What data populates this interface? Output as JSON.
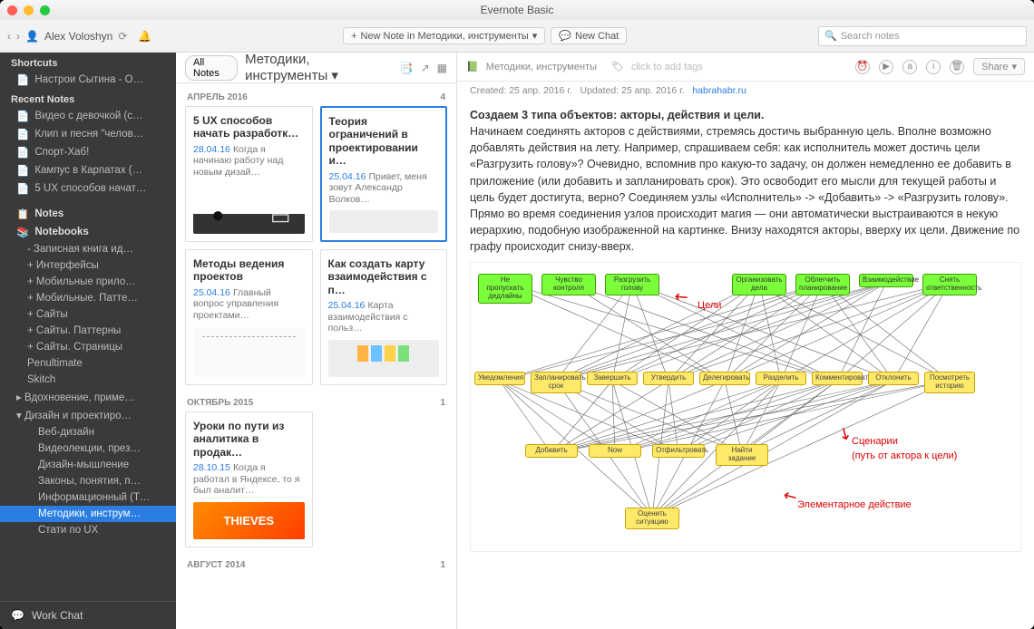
{
  "window_title": "Evernote Basic",
  "toolbar": {
    "user": "Alex Voloshyn",
    "new_note_btn": "New Note in Методики, инструменты",
    "new_chat_btn": "New Chat",
    "search_placeholder": "Search notes"
  },
  "sidebar": {
    "shortcuts_label": "Shortcuts",
    "shortcuts": [
      "Настрои Сытина - О…"
    ],
    "recent_label": "Recent Notes",
    "recent": [
      "Видео с девочкой (с…",
      "Клип и песня \"челов…",
      "Спорт-Хаб!",
      "Кампус в Карпатах (…",
      "5 UX способов начат…"
    ],
    "notes_label": "Notes",
    "notebooks_label": "Notebooks",
    "notebooks": [
      {
        "label": "- Записная книга ид…",
        "lv": 2
      },
      {
        "label": "+ Интерфейсы",
        "lv": 2
      },
      {
        "label": "+ Мобильные прило…",
        "lv": 2
      },
      {
        "label": "+ Мобильные. Патте…",
        "lv": 2
      },
      {
        "label": "+ Сайты",
        "lv": 2
      },
      {
        "label": "+ Сайты. Паттерны",
        "lv": 2
      },
      {
        "label": "+ Сайты. Страницы",
        "lv": 2
      },
      {
        "label": "Penultimate",
        "lv": 2
      },
      {
        "label": "Skitch",
        "lv": 2
      },
      {
        "label": "Вдохновение, приме…",
        "lv": 1,
        "expand": ">"
      },
      {
        "label": "Дизайн и проектиро…",
        "lv": 1,
        "expand": "v"
      },
      {
        "label": "Веб-дизайн",
        "lv": 3
      },
      {
        "label": "Видеолекции, през…",
        "lv": 3
      },
      {
        "label": "Дизайн-мышление",
        "lv": 3
      },
      {
        "label": "Законы, понятия, п…",
        "lv": 3
      },
      {
        "label": "Информационный (Т…",
        "lv": 3
      },
      {
        "label": "Методики, инструм…",
        "lv": 3,
        "selected": true
      },
      {
        "label": "Стати по UX",
        "lv": 3
      }
    ],
    "workchat": "Work Chat"
  },
  "notelist": {
    "all_notes": "All Notes",
    "title": "Методики, инструменты",
    "groups": [
      {
        "label": "АПРЕЛЬ 2016",
        "count": "4"
      },
      {
        "label": "ОКТЯБРЬ 2015",
        "count": "1"
      },
      {
        "label": "АВГУСТ 2014",
        "count": "1"
      }
    ],
    "cards": [
      {
        "title": "5 UX способов начать разработк…",
        "date": "28.04.16",
        "snippet": "Когда я начинаю работу над новым дизай…",
        "thumb": "th1"
      },
      {
        "title": "Теория ограничений в проектировании и…",
        "date": "25.04.16",
        "snippet": "Привет, меня зовут Александр Волков…",
        "thumb": "th2",
        "selected": true
      },
      {
        "title": "Методы ведения проектов",
        "date": "25.04.16",
        "snippet": "Главный вопрос управления проектами…",
        "thumb": "th3"
      },
      {
        "title": "Как создать карту взаимодействия с п…",
        "date": "25.04.16",
        "snippet": "Карта взаимодействия с польз…",
        "thumb": "th4"
      },
      {
        "title": "Уроки по пути из аналитика в продак…",
        "date": "28.10.15",
        "snippet": "Когда я работал в Яндексе, то я был аналит…",
        "thumb": "th5"
      }
    ]
  },
  "note": {
    "notebook": "Методики, инструменты",
    "tags_placeholder": "click to add tags",
    "share": "Share",
    "created": "Created: 25 апр. 2016 г.",
    "updated": "Updated: 25 апр. 2016 г.",
    "source": "habrahabr.ru",
    "para1": "Создаем 3 типа объектов: акторы, действия и цели.",
    "para2": "Начинаем соединять акторов с действиями, стремясь достичь выбранную цель. Вполне возможно добавлять действия на лету. Например, спрашиваем себя: как исполнитель может достичь цели «Разгрузить голову»? Очевидно, вспомнив про какую-то задачу, он должен немедленно ее добавить в приложение (или добавить и запланировать срок). Это освободит его мысли для текущей работы и цель будет достигута, верно? Соединяем узлы «Исполнитель» -> «Добавить» -> «Разгрузить голову».",
    "para3": "Прямо во время соединения узлов происходит магия — они автоматически выстраиваются в некую иерархию, подобную изображенной на картинке. Внизу находятся акторы, вверху их цели. Движение по графу происходит снизу-вверх.",
    "diagram": {
      "goals": [
        "Не пропускать дедлайны",
        "Чувство контроля",
        "Разгрузить голову",
        "",
        "Организовать дела",
        "Облегчить планирование",
        "Взаимодействие",
        "Снять ответственность"
      ],
      "actions_row1": [
        "Уведомления",
        "Запланировать срок",
        "Завершить",
        "Утвердить",
        "Делегировать",
        "Разделить",
        "Комментировать",
        "Отклонить",
        "Посмотреть историю"
      ],
      "actions_row2": [
        "Добавить",
        "Now",
        "Отфильтровать",
        "Найти задание"
      ],
      "actions_row3": [
        "Оценить ситуацию"
      ],
      "label_goals": "Цели",
      "label_scenarios": "Сценарии\n(путь от актора к цели)",
      "label_action": "Элементарное действие"
    }
  }
}
